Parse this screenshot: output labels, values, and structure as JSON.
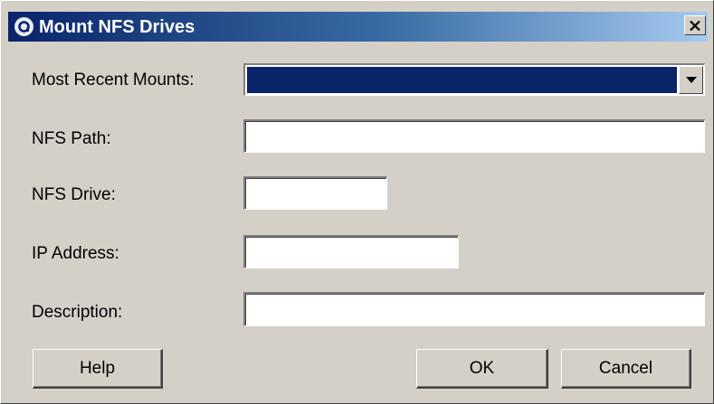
{
  "window": {
    "title": "Mount NFS Drives",
    "title_gradient": [
      "#0a246a",
      "#a6caf0"
    ]
  },
  "icons": {
    "app": "app-logo-icon",
    "close": "close-icon",
    "dropdown": "triangle-down-icon"
  },
  "form": {
    "recent_label": "Most Recent Mounts:",
    "recent_value": "",
    "path_label": "NFS Path:",
    "path_value": "",
    "drive_label": "NFS Drive:",
    "drive_value": "",
    "ip_label": "IP Address:",
    "ip_value": "",
    "description_label": "Description:",
    "description_value": ""
  },
  "buttons": {
    "help": "Help",
    "ok": "OK",
    "cancel": "Cancel"
  }
}
